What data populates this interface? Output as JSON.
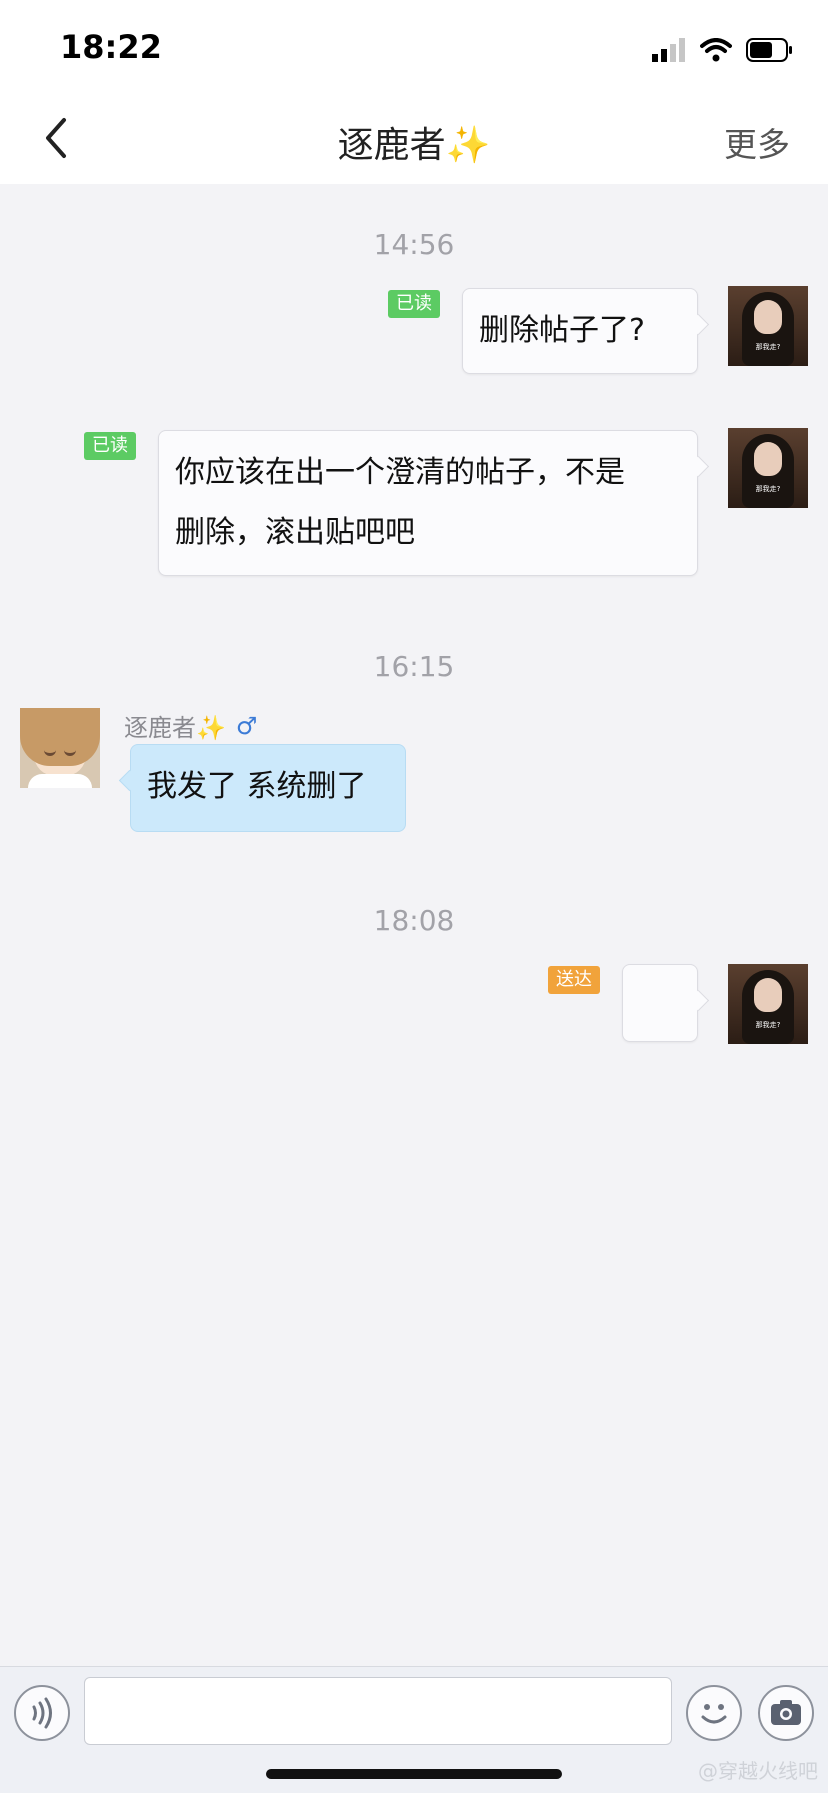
{
  "status_bar": {
    "time": "18:22"
  },
  "nav": {
    "title": "逐鹿者✨",
    "more_label": "更多"
  },
  "messages": {
    "t1": "14:56",
    "m1": {
      "status": "已读",
      "text": "删除帖子了?"
    },
    "m2": {
      "status": "已读",
      "text_line1": "你应该在出一个澄清的帖子，不是",
      "text_line2": "删除，滚出贴吧吧"
    },
    "t2": "16:15",
    "m3": {
      "sender": "逐鹿者✨",
      "gender": "♂",
      "text": "我发了 系统删了"
    },
    "t3": "18:08",
    "m4": {
      "status": "送达",
      "text": ""
    }
  },
  "my_avatar_caption": "那我走?",
  "watermark": "@穿越火线吧",
  "input": {
    "placeholder": ""
  },
  "icons": {
    "back": "chevron-left-icon",
    "voice": "voice-icon",
    "emoji": "emoji-icon",
    "camera": "camera-icon",
    "signal": "signal-icon",
    "wifi": "wifi-icon",
    "battery": "battery-icon"
  },
  "colors": {
    "read_badge": "#5ccb63",
    "sent_badge": "#f1a33b",
    "other_bubble": "#cce9fb"
  }
}
